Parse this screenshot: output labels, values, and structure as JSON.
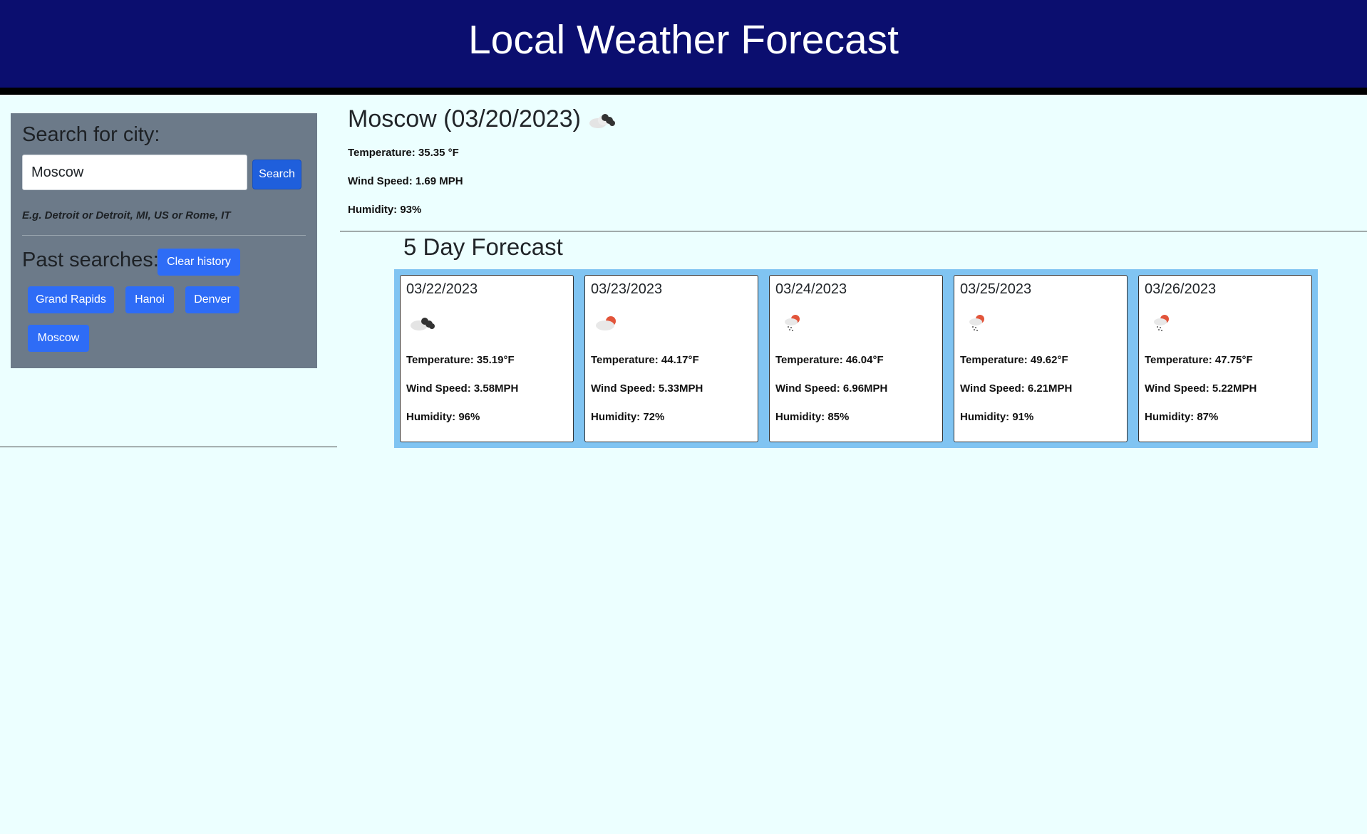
{
  "header": {
    "title": "Local Weather Forecast"
  },
  "sidebar": {
    "search_label": "Search for city:",
    "search_value": "Moscow",
    "search_button": "Search",
    "hint": "E.g. Detroit or Detroit, MI, US or Rome, IT",
    "past_label": "Past searches:",
    "clear_button": "Clear history",
    "history": [
      "Grand Rapids",
      "Hanoi",
      "Denver",
      "Moscow"
    ]
  },
  "current": {
    "title": "Moscow (03/20/2023)",
    "icon": "broken-clouds-icon",
    "temperature": "Temperature: 35.35 °F",
    "wind": "Wind Speed: 1.69 MPH",
    "humidity": "Humidity: 93%"
  },
  "forecast": {
    "title": "5 Day Forecast",
    "days": [
      {
        "date": "03/22/2023",
        "icon": "broken-clouds-icon",
        "temperature": "Temperature: 35.19°F",
        "wind": "Wind Speed: 3.58MPH",
        "humidity": "Humidity: 96%"
      },
      {
        "date": "03/23/2023",
        "icon": "cloud-sun-icon",
        "temperature": "Temperature: 44.17°F",
        "wind": "Wind Speed: 5.33MPH",
        "humidity": "Humidity: 72%"
      },
      {
        "date": "03/24/2023",
        "icon": "snow-sun-icon",
        "temperature": "Temperature: 46.04°F",
        "wind": "Wind Speed: 6.96MPH",
        "humidity": "Humidity: 85%"
      },
      {
        "date": "03/25/2023",
        "icon": "snow-sun-icon",
        "temperature": "Temperature: 49.62°F",
        "wind": "Wind Speed: 6.21MPH",
        "humidity": "Humidity: 91%"
      },
      {
        "date": "03/26/2023",
        "icon": "snow-sun-icon",
        "temperature": "Temperature: 47.75°F",
        "wind": "Wind Speed: 5.22MPH",
        "humidity": "Humidity: 87%"
      }
    ]
  },
  "colors": {
    "header_bg": "#0b0e6f",
    "page_bg": "#ecffff",
    "sidebar_bg": "#6c7a89",
    "button": "#2e6cf6",
    "forecast_bg": "#80c4f2"
  }
}
